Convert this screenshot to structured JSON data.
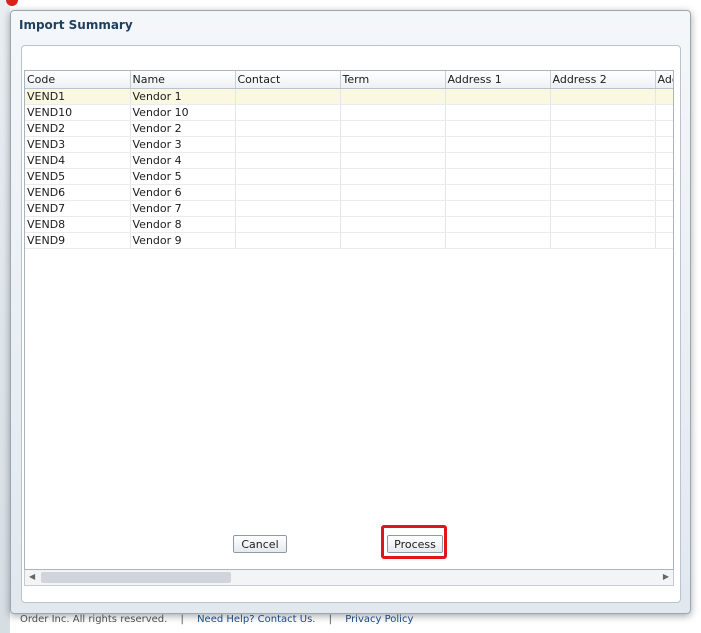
{
  "background": {
    "footer": {
      "copyright": "Order Inc. All rights reserved.",
      "help_link": "Need Help? Contact Us.",
      "privacy_link": "Privacy Policy"
    }
  },
  "dialog": {
    "title": "Import Summary",
    "table": {
      "columns": [
        "Code",
        "Name",
        "Contact",
        "Term",
        "Address 1",
        "Address 2",
        "Add"
      ],
      "rows": [
        {
          "code": "VEND1",
          "name": "Vendor 1"
        },
        {
          "code": "VEND10",
          "name": "Vendor 10"
        },
        {
          "code": "VEND2",
          "name": "Vendor 2"
        },
        {
          "code": "VEND3",
          "name": "Vendor 3"
        },
        {
          "code": "VEND4",
          "name": "Vendor 4"
        },
        {
          "code": "VEND5",
          "name": "Vendor 5"
        },
        {
          "code": "VEND6",
          "name": "Vendor 6"
        },
        {
          "code": "VEND7",
          "name": "Vendor 7"
        },
        {
          "code": "VEND8",
          "name": "Vendor 8"
        },
        {
          "code": "VEND9",
          "name": "Vendor 9"
        }
      ]
    },
    "buttons": {
      "cancel": "Cancel",
      "process": "Process"
    }
  },
  "colors": {
    "title": "#1f3f5f",
    "selected_row": "#fbf8e2",
    "highlight": "#e0141c"
  }
}
